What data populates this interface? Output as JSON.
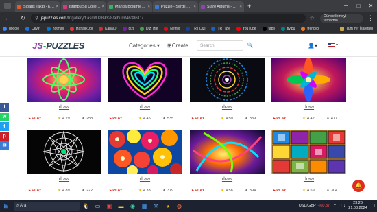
{
  "browser": {
    "tabs": [
      {
        "label": "Siparis Takip - KitapdeSori",
        "color": "#e05a2a"
      },
      {
        "label": "istanbulSu Dolle 2-Bolum",
        "color": "#d43b7a"
      },
      {
        "label": "Manga Bolumleme Oyunu",
        "color": "#3bb05e"
      },
      {
        "label": "Puzzle - Sergil Eray - Cizi",
        "color": "#3b78d4"
      },
      {
        "label": "Stare Albums - zaBook",
        "color": "#8e44ad"
      }
    ],
    "url_host": "jspuzzles.com",
    "url_path": "/tr/gallery/t.asm/U289328/album/4638611/",
    "profile_label": "Güncellemeyi tamamla",
    "bookmarks": [
      {
        "label": "google",
        "color": "#4285f4"
      },
      {
        "label": "Çeviri",
        "color": "#1a73e8"
      },
      {
        "label": "hotmail",
        "color": "#0078d4"
      },
      {
        "label": "HaftalikDoi",
        "color": "#e53935"
      },
      {
        "label": "KanalD",
        "color": "#d32f2f"
      },
      {
        "label": "dizi",
        "color": "#7b1fa2"
      },
      {
        "label": "Dizi izle",
        "color": "#43a047"
      },
      {
        "label": "Netflix",
        "color": "#e50914"
      },
      {
        "label": "TRT Dizi",
        "color": "#0d47a1"
      },
      {
        "label": "TRT izle",
        "color": "#1565c0"
      },
      {
        "label": "YouTube",
        "color": "#ff0000"
      },
      {
        "label": "tabii",
        "color": "#000000"
      },
      {
        "label": "tivibu",
        "color": "#00838f"
      },
      {
        "label": "trendyol",
        "color": "#f27a1a"
      }
    ],
    "bookmarks_folder": "Tüm Yer İşaretleri"
  },
  "site": {
    "logo_js": "JS",
    "logo_dash": "-",
    "logo_puzzles": "PUZZLES",
    "categories_label": "Categories",
    "create_label": "Create",
    "search_placeholder": "Search"
  },
  "share_buttons": [
    {
      "icon": "facebook-icon",
      "glyph": "f",
      "color": "#3b5998"
    },
    {
      "icon": "whatsapp-icon",
      "glyph": "w",
      "color": "#25d366"
    },
    {
      "icon": "twitter-icon",
      "glyph": "t",
      "color": "#1da1f2"
    },
    {
      "icon": "pinterest-icon",
      "glyph": "p",
      "color": "#cb2027"
    },
    {
      "icon": "email-icon",
      "glyph": "✉",
      "color": "#3a7bd5"
    }
  ],
  "gallery": [
    {
      "title": "draw",
      "play": "PLAY",
      "rating": "4.29",
      "plays": "258"
    },
    {
      "title": "draw",
      "play": "PLAY",
      "rating": "4.45",
      "plays": "535"
    },
    {
      "title": "draw",
      "play": "PLAY",
      "rating": "4.50",
      "plays": "389"
    },
    {
      "title": "draw",
      "play": "PLAY",
      "rating": "4.42",
      "plays": "477"
    },
    {
      "title": "draw",
      "play": "PLAY",
      "rating": "4.89",
      "plays": "222"
    },
    {
      "title": "draw",
      "play": "PLAY",
      "rating": "4.33",
      "plays": "379"
    },
    {
      "title": "draw",
      "play": "PLAY",
      "rating": "4.58",
      "plays": "394"
    },
    {
      "title": "draw",
      "play": "PLAY",
      "rating": "4.59",
      "plays": "304"
    }
  ],
  "taskbar": {
    "search_label": "Ara",
    "ticker": "USD/GBP",
    "change": "-%0.37",
    "time": "23:26",
    "date": "21.08.2024"
  }
}
